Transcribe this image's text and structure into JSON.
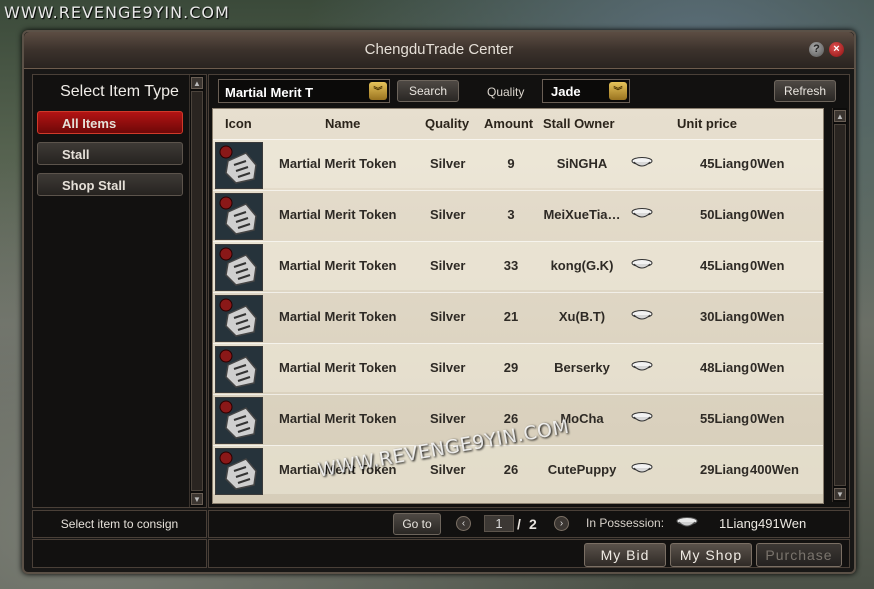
{
  "watermark": "WWW.REVENGE9YIN.COM",
  "watermark_overlay": "WWW.REVENGE9YIN.COM",
  "window": {
    "title": "ChengduTrade Center",
    "help_label": "?",
    "close_label": "×"
  },
  "left": {
    "title": "Select Item Type",
    "categories": [
      {
        "label": "All Items",
        "active": true
      },
      {
        "label": "Stall",
        "active": false
      },
      {
        "label": "Shop Stall",
        "active": false
      }
    ],
    "consign_text": "Select item to consign"
  },
  "search": {
    "value": "Martial Merit T",
    "button_label": "Search"
  },
  "quality": {
    "label": "Quality",
    "value": "Jade"
  },
  "refresh_label": "Refresh",
  "table": {
    "headers": {
      "icon": "Icon",
      "name": "Name",
      "quality": "Quality",
      "amount": "Amount",
      "owner": "Stall Owner",
      "price": "Unit price"
    },
    "rows": [
      {
        "name": "Martial Merit Token",
        "quality": "Silver",
        "amount": "9",
        "owner": "SiNGHA",
        "liang": "45Liang",
        "wen": "0Wen"
      },
      {
        "name": "Martial Merit Token",
        "quality": "Silver",
        "amount": "3",
        "owner": "MeiXueTia…",
        "liang": "50Liang",
        "wen": "0Wen"
      },
      {
        "name": "Martial Merit Token",
        "quality": "Silver",
        "amount": "33",
        "owner": "kong(G.K)",
        "liang": "45Liang",
        "wen": "0Wen"
      },
      {
        "name": "Martial Merit Token",
        "quality": "Silver",
        "amount": "21",
        "owner": "Xu(B.T)",
        "liang": "30Liang",
        "wen": "0Wen"
      },
      {
        "name": "Martial Merit Token",
        "quality": "Silver",
        "amount": "29",
        "owner": "Berserky",
        "liang": "48Liang",
        "wen": "0Wen"
      },
      {
        "name": "Martial Merit Token",
        "quality": "Silver",
        "amount": "26",
        "owner": "MoCha",
        "liang": "55Liang",
        "wen": "0Wen"
      },
      {
        "name": "Martial Merit Token",
        "quality": "Silver",
        "amount": "26",
        "owner": "CutePuppy",
        "liang": "29Liang",
        "wen": "400Wen"
      }
    ]
  },
  "pager": {
    "goto_label": "Go to",
    "current": "1",
    "separator": "/",
    "total": "2",
    "possession_label": "In Possession:",
    "possession_value": "1Liang491Wen"
  },
  "actions": {
    "my_bid": "My Bid",
    "my_shop": "My Shop",
    "purchase": "Purchase"
  },
  "icons": {
    "help": "help-icon",
    "close": "close-icon",
    "dropdown": "chevron-down-icon",
    "currency": "silver-ingot-icon",
    "item": "martial-merit-token-icon"
  },
  "colors": {
    "price_green": "#0fa83a",
    "active_category": "#b31414"
  }
}
